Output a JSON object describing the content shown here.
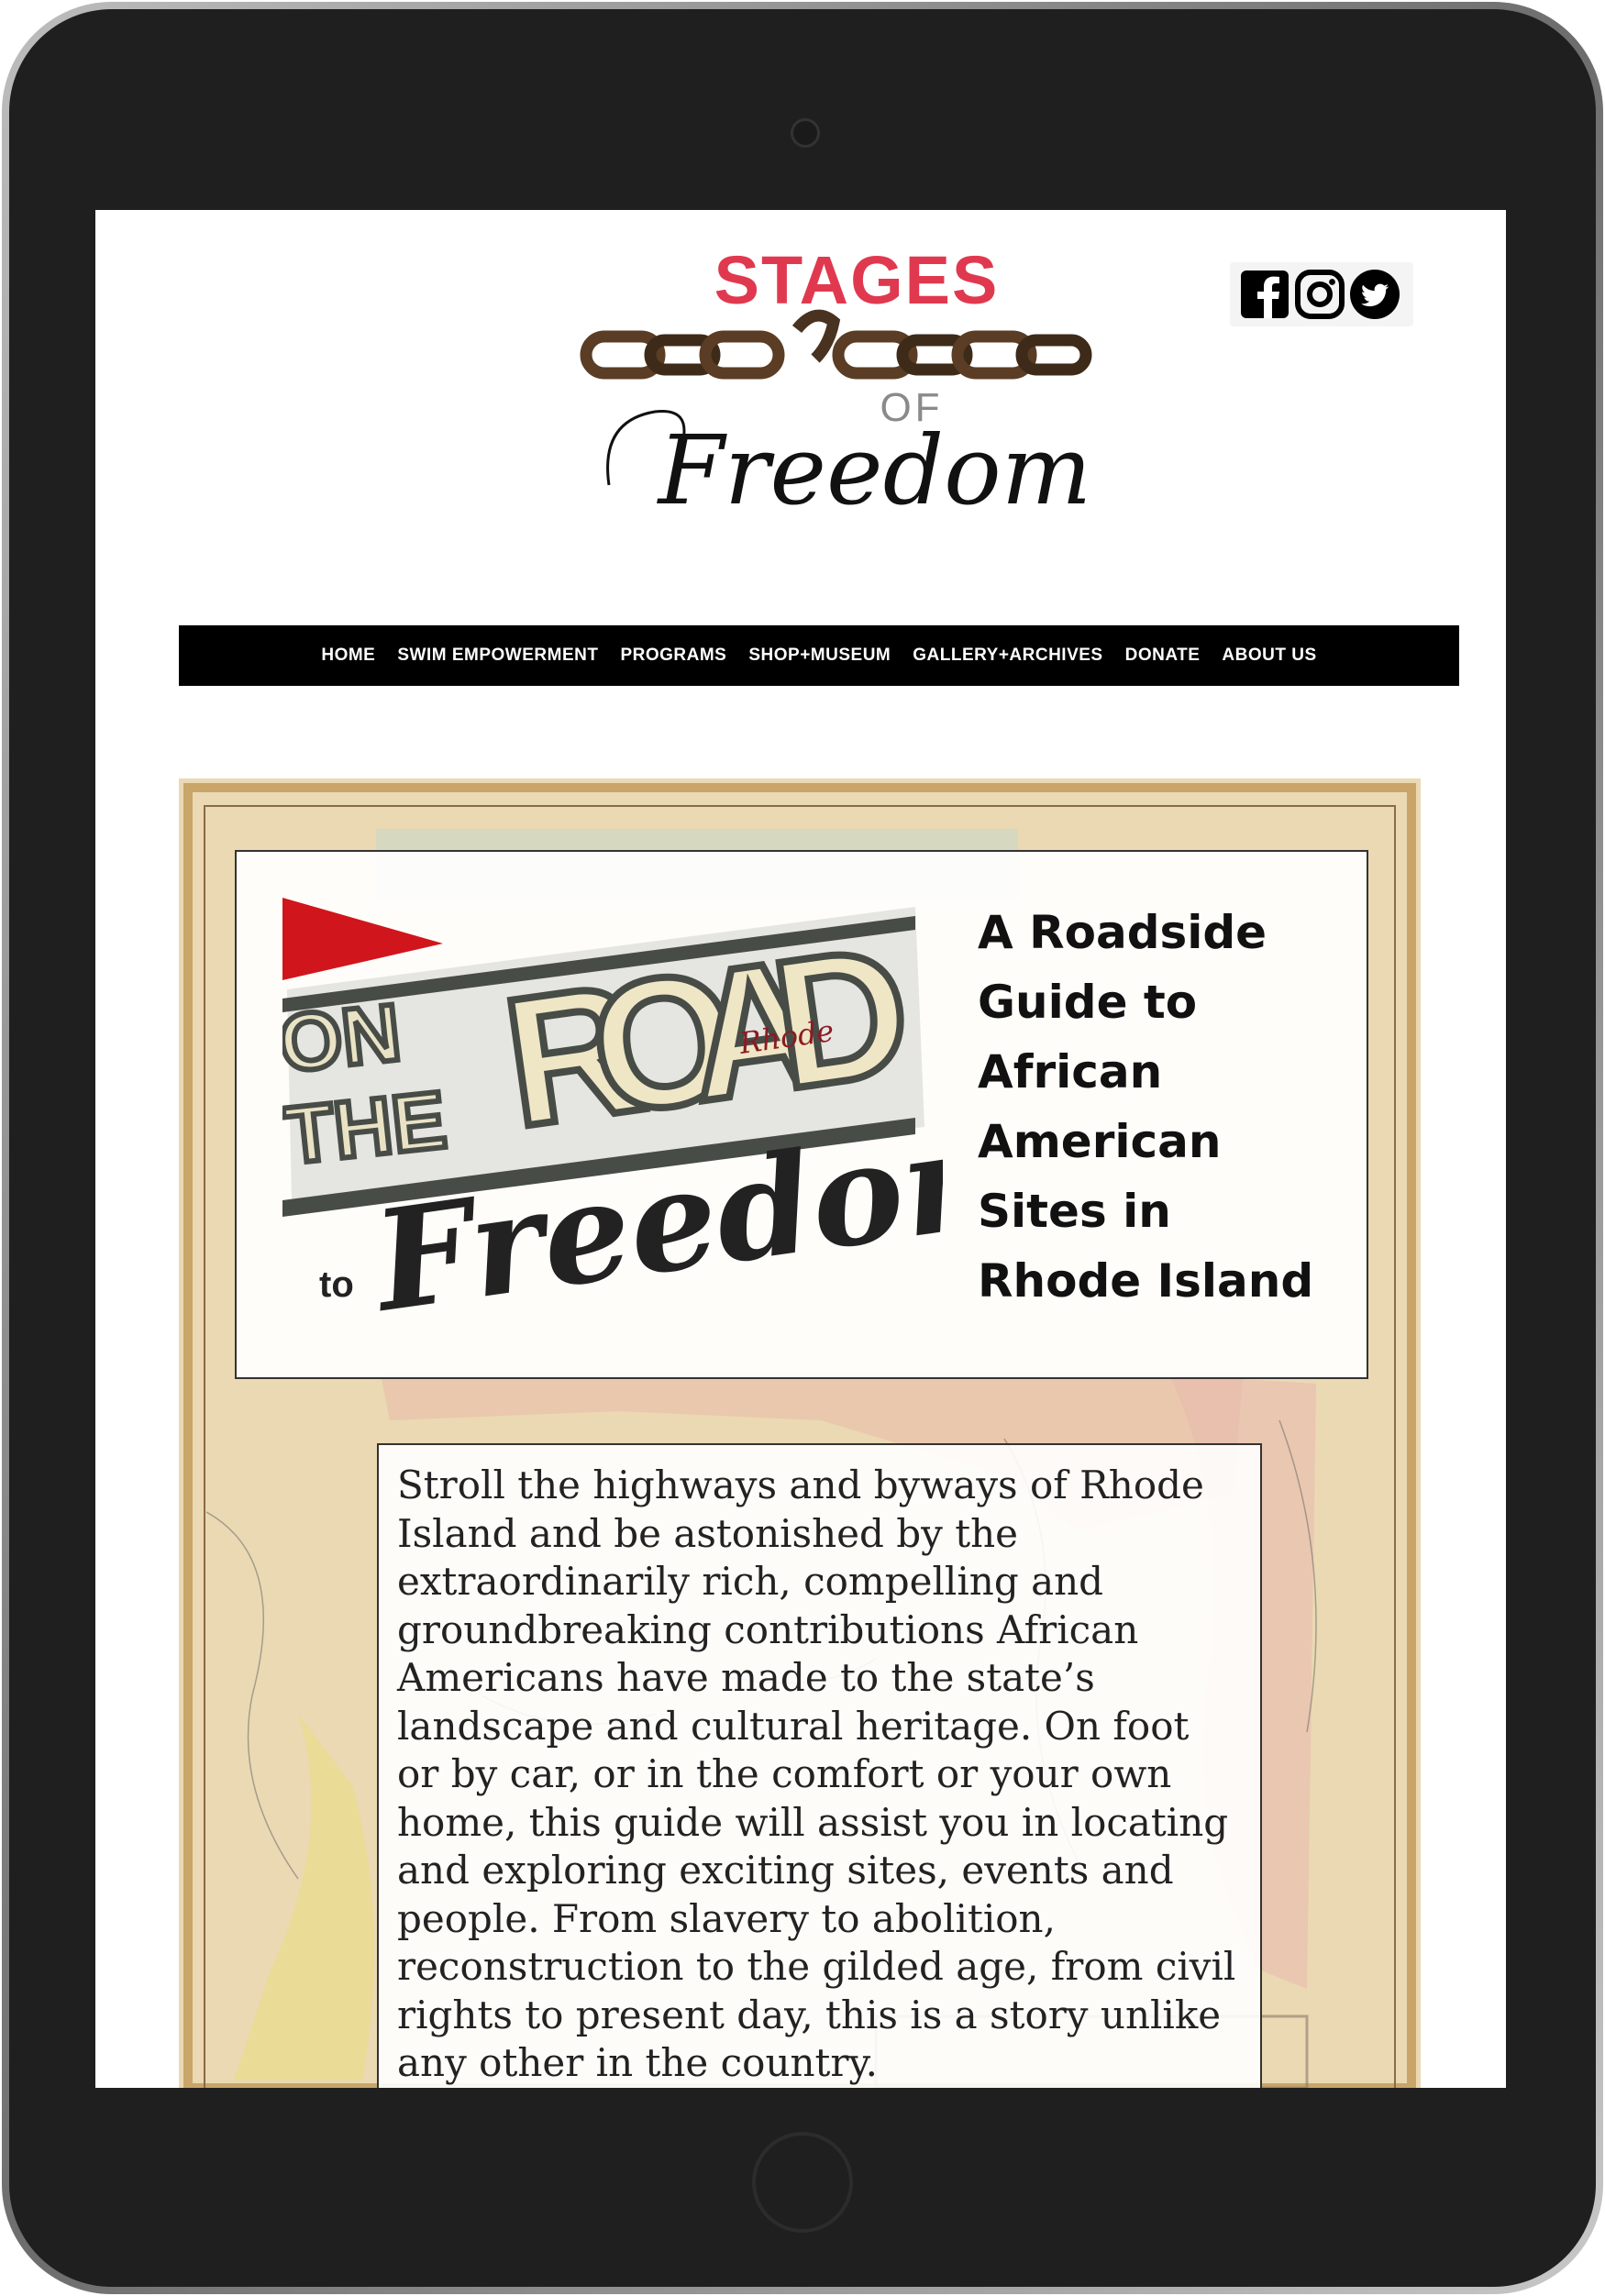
{
  "logo": {
    "line1": "STAGES",
    "line2": "OF",
    "line3": "Freedom"
  },
  "social": {
    "icons": [
      "facebook-icon",
      "instagram-icon",
      "twitter-icon"
    ]
  },
  "nav": {
    "items": [
      "HOME",
      "SWIM EMPOWERMENT",
      "PROGRAMS",
      "SHOP+MUSEUM",
      "GALLERY+ARCHIVES",
      "DONATE",
      "ABOUT US"
    ]
  },
  "hero": {
    "sign": {
      "on": "ON",
      "the": "THE",
      "road": "ROAD",
      "rhode": "Rhode",
      "to": "to",
      "freedom": "Freedom"
    },
    "subtitle_lines": [
      "A Roadside",
      "Guide to",
      "African",
      "American",
      "Sites in",
      "Rhode Island"
    ],
    "body": "Stroll the highways and byways of Rhode Island and be astonished by the extraordinarily rich, compelling and groundbreaking contributions African Americans have made to the state’s landscape and cultural heritage. On foot or by car, or in the comfort or your own home, this guide will assist you in locating and exploring exciting sites, events and people. From slavery to abolition, reconstruction to the gilded age, from civil rights to present day, this is a story unlike any other in the country."
  },
  "colors": {
    "device_frame": "#1e1e1e",
    "stages_red": "#e0394f",
    "nav_bg": "#000000",
    "flag_red": "#d0161c",
    "map_tan": "#e8d6ad"
  }
}
